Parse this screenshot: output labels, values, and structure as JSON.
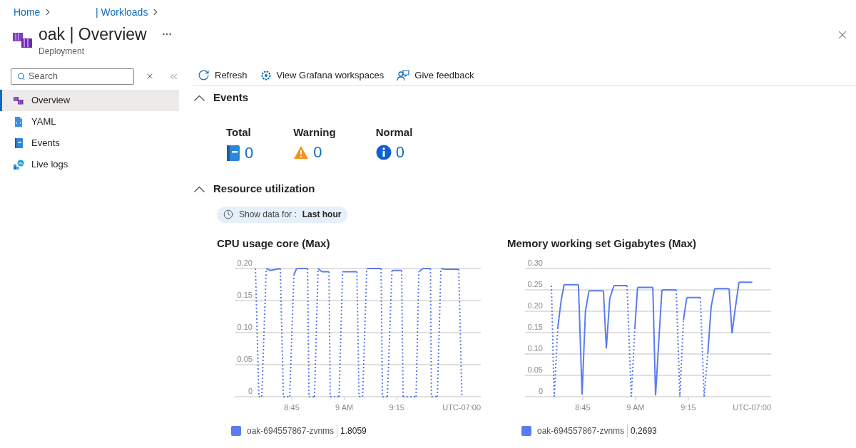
{
  "breadcrumb": [
    {
      "label": "Home"
    },
    {
      "label": "| Workloads"
    }
  ],
  "header": {
    "title": "oak | Overview",
    "subtitle": "Deployment"
  },
  "sidebar": {
    "search": {
      "placeholder": "Search"
    },
    "items": [
      {
        "label": "Overview",
        "kind": "overview",
        "selected": true
      },
      {
        "label": "YAML",
        "kind": "yaml",
        "selected": false
      },
      {
        "label": "Events",
        "kind": "events",
        "selected": false
      },
      {
        "label": "Live logs",
        "kind": "logs",
        "selected": false
      }
    ]
  },
  "toolbar": [
    {
      "label": "Refresh",
      "kind": "refresh"
    },
    {
      "label": "View Grafana workspaces",
      "kind": "grafana"
    },
    {
      "label": "Give feedback",
      "kind": "feedback"
    }
  ],
  "events": {
    "title": "Events",
    "expanded": true,
    "counters": [
      {
        "label": "Total",
        "value": "0",
        "kind": "total"
      },
      {
        "label": "Warning",
        "value": "0",
        "kind": "warning"
      },
      {
        "label": "Normal",
        "value": "0",
        "kind": "normal"
      }
    ]
  },
  "resource_utilization": {
    "title": "Resource utilization",
    "expanded": true,
    "time_filter": {
      "label": "Show data for :",
      "value": "Last hour"
    },
    "charts": [
      {
        "timezone": "UTC-07:00",
        "legend_value": "1.8059",
        "chart_data": {
          "type": "line",
          "title": "CPU usage core (Max)",
          "x": [
            8.577,
            8.593,
            8.607,
            8.628,
            8.648,
            8.695,
            8.71,
            8.74,
            8.76,
            8.773,
            8.825,
            8.832,
            8.852,
            8.858,
            8.875,
            8.893,
            8.927,
            8.933,
            8.975,
            8.992,
            9.06,
            9.07,
            9.087,
            9.107,
            9.175,
            9.182,
            9.205,
            9.227,
            9.24,
            9.273,
            9.28,
            9.342,
            9.355,
            9.375,
            9.41,
            9.415,
            9.443,
            9.46,
            9.477,
            9.545,
            9.56
          ],
          "series": [
            {
              "name": "oak-694557867-zvnms",
              "color": "#5b7cf0",
              "values": [
                0.2,
                0,
                0,
                0.2,
                0.197,
                0.2,
                0,
                0,
                0.19,
                0.2,
                0.2,
                0,
                0,
                0,
                0.2,
                0.195,
                0.195,
                0,
                0,
                0.195,
                0.195,
                0,
                0,
                0.2,
                0.2,
                0,
                0,
                0.197,
                0.197,
                0.197,
                0,
                0,
                0.195,
                0.2,
                0.2,
                0,
                0,
                0.2,
                0.199,
                0.199,
                0
              ]
            }
          ],
          "grid": true,
          "xlim": [
            8.478,
            9.65
          ],
          "ylim": [
            0,
            0.2
          ],
          "xticks": [
            {
              "value": 8.75,
              "label": "8:45"
            },
            {
              "value": 9,
              "label": "9 AM"
            },
            {
              "value": 9.25,
              "label": "9:15"
            }
          ],
          "yticks": [
            {
              "value": 0,
              "label": "0"
            },
            {
              "value": 0.05,
              "label": "0.05"
            },
            {
              "value": 0.1,
              "label": "0.10"
            },
            {
              "value": 0.15,
              "label": "0.15"
            },
            {
              "value": 0.2,
              "label": "0.20"
            }
          ]
        }
      },
      {
        "timezone": "UTC-07:00",
        "legend_value": "0.2693",
        "chart_data": {
          "type": "line",
          "title": "Memory working set Gigabytes (Max)",
          "x": [
            8.602,
            8.615,
            8.632,
            8.648,
            8.662,
            8.73,
            8.747,
            8.763,
            8.78,
            8.848,
            8.862,
            8.878,
            8.898,
            8.96,
            8.98,
            8.997,
            9.01,
            9.082,
            9.095,
            9.125,
            9.193,
            9.21,
            9.227,
            9.243,
            9.307,
            9.325,
            9.342,
            9.358,
            9.375,
            9.443,
            9.457,
            9.473,
            9.49,
            9.553
          ],
          "series": [
            {
              "name": "oak-694557867-zvnms",
              "color": "#5b7cf0",
              "values": [
                0.26,
                0,
                0.16,
                0.225,
                0.262,
                0.262,
                0.005,
                0.2,
                0.248,
                0.248,
                0.113,
                0.23,
                0.26,
                0.26,
                0,
                0.16,
                0.256,
                0.256,
                0.003,
                0.25,
                0.25,
                0,
                0.18,
                0.232,
                0.232,
                0,
                0.1,
                0.21,
                0.253,
                0.253,
                0.148,
                0.21,
                0.268,
                0.268
              ]
            }
          ],
          "grid": true,
          "xlim": [
            8.477,
            9.642
          ],
          "ylim": [
            0,
            0.3
          ],
          "xticks": [
            {
              "value": 8.75,
              "label": "8:45"
            },
            {
              "value": 9,
              "label": "9 AM"
            },
            {
              "value": 9.25,
              "label": "9:15"
            }
          ],
          "yticks": [
            {
              "value": 0,
              "label": "0"
            },
            {
              "value": 0.05,
              "label": "0.05"
            },
            {
              "value": 0.1,
              "label": "0.10"
            },
            {
              "value": 0.15,
              "label": "0.15"
            },
            {
              "value": 0.2,
              "label": "0.20"
            },
            {
              "value": 0.25,
              "label": "0.25"
            },
            {
              "value": 0.3,
              "label": "0.30"
            }
          ]
        }
      }
    ]
  }
}
